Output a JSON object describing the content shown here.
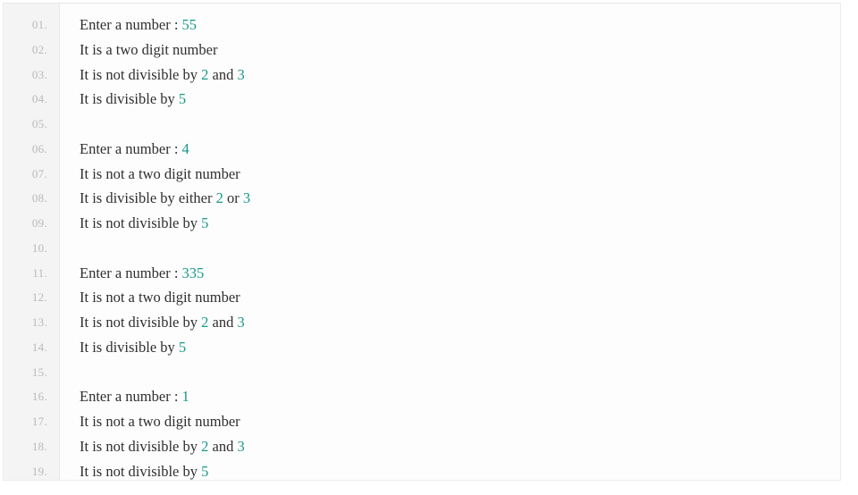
{
  "console": {
    "name": "program-output-console",
    "gutter_label": "line-numbers",
    "colors": {
      "background": "#fdfdfd",
      "gutter_background": "#f4f4f4",
      "text": "#2f2f2f",
      "line_number": "#b9b9b9",
      "number_accent": "#18998a",
      "panel_border": "#ececec"
    },
    "lines": [
      {
        "number": "01.",
        "segments": [
          {
            "text": "Enter a number : ",
            "kind": "text"
          },
          {
            "text": "55",
            "kind": "number"
          }
        ]
      },
      {
        "number": "02.",
        "segments": [
          {
            "text": "It is a two digit number",
            "kind": "text"
          }
        ]
      },
      {
        "number": "03.",
        "segments": [
          {
            "text": "It is not divisible by ",
            "kind": "text"
          },
          {
            "text": "2",
            "kind": "number"
          },
          {
            "text": " and ",
            "kind": "text"
          },
          {
            "text": "3",
            "kind": "number"
          }
        ]
      },
      {
        "number": "04.",
        "segments": [
          {
            "text": "It is divisible by ",
            "kind": "text"
          },
          {
            "text": "5",
            "kind": "number"
          }
        ]
      },
      {
        "number": "05.",
        "segments": []
      },
      {
        "number": "06.",
        "segments": [
          {
            "text": "Enter a number : ",
            "kind": "text"
          },
          {
            "text": "4",
            "kind": "number"
          }
        ]
      },
      {
        "number": "07.",
        "segments": [
          {
            "text": "It is not a two digit number",
            "kind": "text"
          }
        ]
      },
      {
        "number": "08.",
        "segments": [
          {
            "text": "It is divisible by either ",
            "kind": "text"
          },
          {
            "text": "2",
            "kind": "number"
          },
          {
            "text": " or ",
            "kind": "text"
          },
          {
            "text": "3",
            "kind": "number"
          }
        ]
      },
      {
        "number": "09.",
        "segments": [
          {
            "text": "It is not divisible by ",
            "kind": "text"
          },
          {
            "text": "5",
            "kind": "number"
          }
        ]
      },
      {
        "number": "10.",
        "segments": []
      },
      {
        "number": "11.",
        "segments": [
          {
            "text": "Enter a number : ",
            "kind": "text"
          },
          {
            "text": "335",
            "kind": "number"
          }
        ]
      },
      {
        "number": "12.",
        "segments": [
          {
            "text": "It is not a two digit number",
            "kind": "text"
          }
        ]
      },
      {
        "number": "13.",
        "segments": [
          {
            "text": "It is not divisible by ",
            "kind": "text"
          },
          {
            "text": "2",
            "kind": "number"
          },
          {
            "text": " and ",
            "kind": "text"
          },
          {
            "text": "3",
            "kind": "number"
          }
        ]
      },
      {
        "number": "14.",
        "segments": [
          {
            "text": "It is divisible by ",
            "kind": "text"
          },
          {
            "text": "5",
            "kind": "number"
          }
        ]
      },
      {
        "number": "15.",
        "segments": []
      },
      {
        "number": "16.",
        "segments": [
          {
            "text": "Enter a number : ",
            "kind": "text"
          },
          {
            "text": "1",
            "kind": "number"
          }
        ]
      },
      {
        "number": "17.",
        "segments": [
          {
            "text": "It is not a two digit number",
            "kind": "text"
          }
        ]
      },
      {
        "number": "18.",
        "segments": [
          {
            "text": "It is not divisible by ",
            "kind": "text"
          },
          {
            "text": "2",
            "kind": "number"
          },
          {
            "text": " and ",
            "kind": "text"
          },
          {
            "text": "3",
            "kind": "number"
          }
        ]
      },
      {
        "number": "19.",
        "segments": [
          {
            "text": "It is not divisible by ",
            "kind": "text"
          },
          {
            "text": "5",
            "kind": "number"
          }
        ]
      }
    ]
  }
}
